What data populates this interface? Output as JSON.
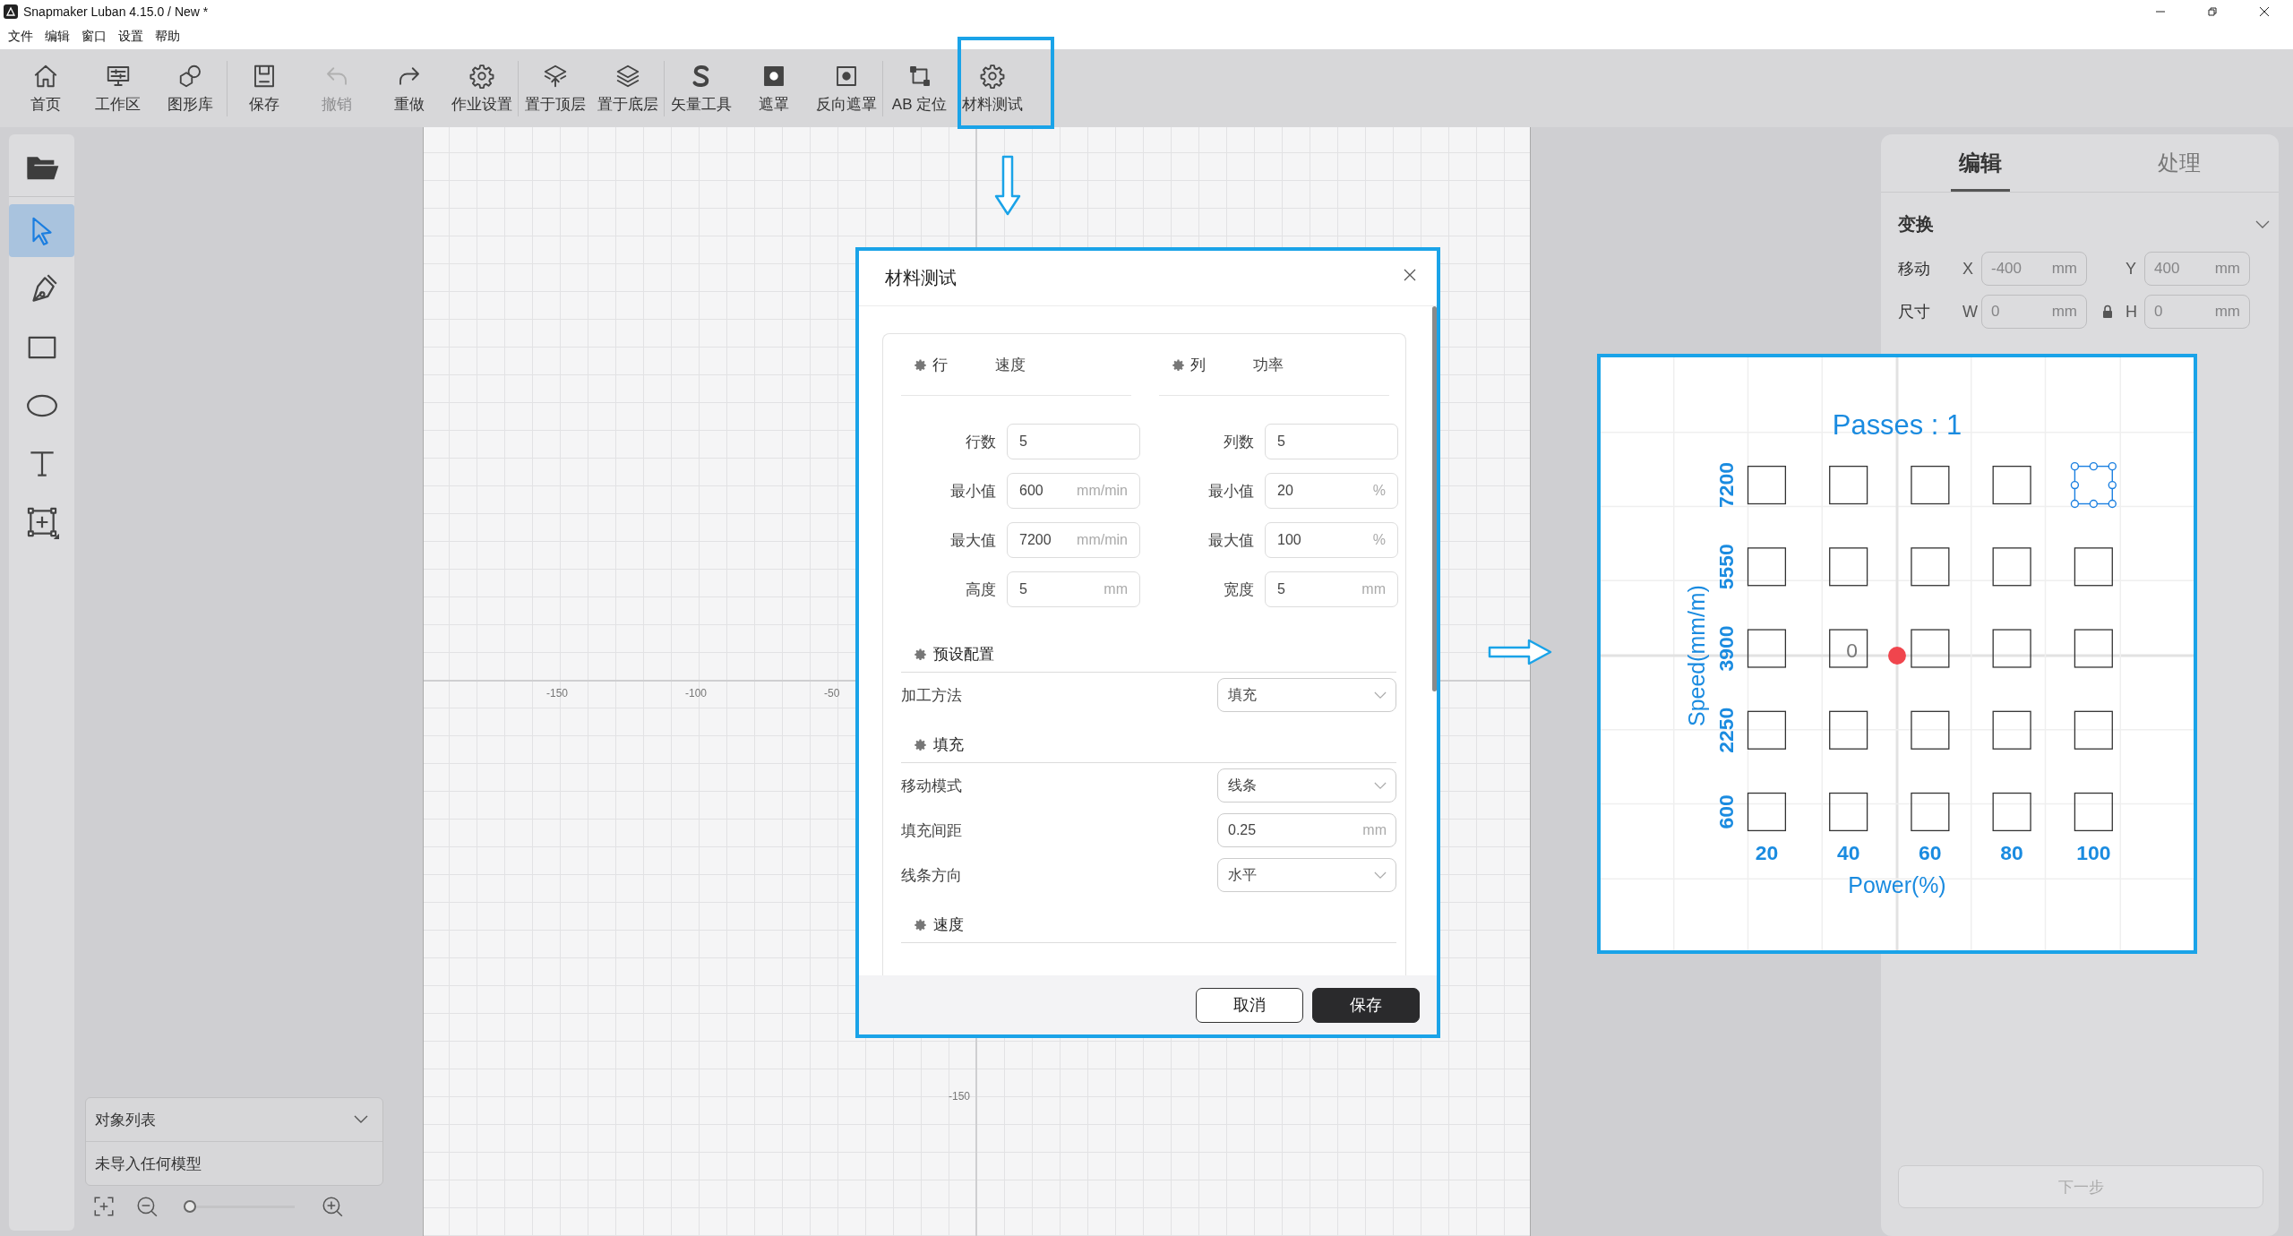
{
  "window": {
    "title": "Snapmaker Luban 4.15.0 / New *"
  },
  "menu": [
    "文件",
    "编辑",
    "窗口",
    "设置",
    "帮助"
  ],
  "toolbar": {
    "groups": [
      {
        "items": [
          {
            "label": "首页",
            "disabled": false
          },
          {
            "label": "工作区",
            "disabled": false
          },
          {
            "label": "图形库",
            "disabled": false
          }
        ]
      },
      {
        "items": [
          {
            "label": "保存",
            "disabled": false
          },
          {
            "label": "撤销",
            "disabled": true
          },
          {
            "label": "重做",
            "disabled": false
          },
          {
            "label": "作业设置",
            "disabled": false
          }
        ]
      },
      {
        "items": [
          {
            "label": "置于顶层",
            "disabled": false
          },
          {
            "label": "置于底层",
            "disabled": false
          }
        ]
      },
      {
        "items": [
          {
            "label": "矢量工具",
            "disabled": false
          },
          {
            "label": "遮罩",
            "disabled": false
          },
          {
            "label": "反向遮罩",
            "disabled": false
          }
        ]
      },
      {
        "items": [
          {
            "label": "AB 定位",
            "disabled": false
          },
          {
            "label": "材料测试",
            "disabled": false
          }
        ]
      }
    ]
  },
  "tools": [
    {
      "selected": true
    },
    {
      "selected": false
    },
    {
      "selected": false
    },
    {
      "selected": false
    },
    {
      "selected": false
    },
    {
      "selected": false
    }
  ],
  "object_list": {
    "title": "对象列表",
    "empty_text": "未导入任何模型"
  },
  "zoom_slider": {
    "level": 0.05
  },
  "canvas": {
    "x_labels": [
      "-150",
      "-100",
      "-50"
    ],
    "y_labels": [
      "-150"
    ]
  },
  "dialog": {
    "title": "材料测试",
    "row_header": {
      "label": "行",
      "value": "速度"
    },
    "column_header": {
      "label": "列",
      "value": "功率"
    },
    "row_fields": [
      {
        "label": "行数",
        "value": "5"
      },
      {
        "label": "最小值",
        "value": "600",
        "unit": "mm/min"
      },
      {
        "label": "最大值",
        "value": "7200",
        "unit": "mm/min"
      },
      {
        "label": "高度",
        "value": "5",
        "unit": "mm"
      }
    ],
    "column_fields": [
      {
        "label": "列数",
        "value": "5"
      },
      {
        "label": "最小值",
        "value": "20",
        "unit": "%"
      },
      {
        "label": "最大值",
        "value": "100",
        "unit": "%"
      },
      {
        "label": "宽度",
        "value": "5",
        "unit": "mm"
      }
    ],
    "sections": [
      {
        "title": "预设配置",
        "fields": [
          {
            "label": "加工方法",
            "kind": "select",
            "value": "填充"
          }
        ]
      },
      {
        "title": "填充",
        "fields": [
          {
            "label": "移动模式",
            "kind": "select",
            "value": "线条"
          },
          {
            "label": "填充间距",
            "kind": "input",
            "value": "0.25",
            "unit": "mm"
          },
          {
            "label": "线条方向",
            "kind": "select",
            "value": "水平"
          }
        ]
      },
      {
        "title": "速度"
      }
    ],
    "buttons": [
      {
        "label": "取消",
        "kind": "secondary"
      },
      {
        "label": "保存",
        "kind": "primary"
      }
    ]
  },
  "right_panel": {
    "tabs": [
      {
        "label": "编辑",
        "selected": true
      },
      {
        "label": "处理",
        "selected": false
      }
    ],
    "section": {
      "title": "变换",
      "expanded": true
    },
    "rows": [
      {
        "label": "移动",
        "fields": [
          {
            "axis": "X",
            "value": "-400",
            "unit": "mm",
            "disabled": true
          },
          {
            "axis": "Y",
            "value": "400",
            "unit": "mm",
            "disabled": true
          }
        ]
      },
      {
        "label": "尺寸",
        "locked": true,
        "fields": [
          {
            "axis": "W",
            "value": "0",
            "unit": "mm",
            "disabled": true
          },
          {
            "axis": "H",
            "value": "0",
            "unit": "mm",
            "disabled": true
          }
        ]
      }
    ],
    "next_button": {
      "label": "下一步",
      "disabled": true
    }
  },
  "preview": {
    "title": "Passes : 1",
    "y_axis_label": "Speed(mm/m)",
    "x_axis_label": "Power(%)",
    "column_labels": [
      "20",
      "40",
      "60",
      "80",
      "100"
    ],
    "rows": [
      {
        "label": "7200",
        "cells": [
          {
            "selected": false
          },
          {
            "selected": false
          },
          {
            "selected": false
          },
          {
            "selected": false
          },
          {
            "selected": true
          }
        ]
      },
      {
        "label": "5550",
        "cells": [
          {
            "selected": false
          },
          {
            "selected": false
          },
          {
            "selected": false
          },
          {
            "selected": false
          },
          {
            "selected": false
          }
        ]
      },
      {
        "label": "3900",
        "cells": [
          {
            "selected": false
          },
          {
            "selected": false,
            "text": "0"
          },
          {
            "selected": false
          },
          {
            "selected": false
          },
          {
            "selected": false
          }
        ]
      },
      {
        "label": "2250",
        "cells": [
          {
            "selected": false
          },
          {
            "selected": false
          },
          {
            "selected": false
          },
          {
            "selected": false
          },
          {
            "selected": false
          }
        ]
      },
      {
        "label": "600",
        "cells": [
          {
            "selected": false
          },
          {
            "selected": false
          },
          {
            "selected": false
          },
          {
            "selected": false
          },
          {
            "selected": false
          }
        ]
      }
    ]
  }
}
